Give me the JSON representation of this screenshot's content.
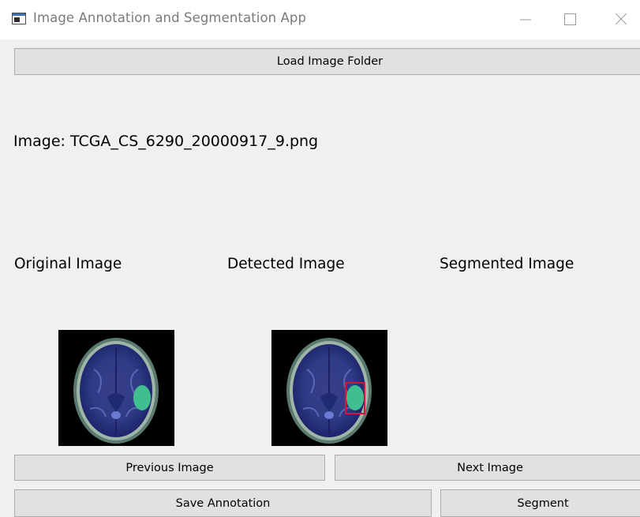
{
  "window": {
    "title": "Image Annotation and Segmentation App",
    "app_icon": "window-app-icon",
    "controls": [
      "minimize-icon",
      "maximize-icon",
      "close-icon"
    ]
  },
  "toolbar": {
    "load_label": "Load Image Folder"
  },
  "current_image": {
    "label": "Image: TCGA_CS_6290_20000917_9.png"
  },
  "panels": {
    "original": "Original Image",
    "detected": "Detected Image",
    "segmented": "Segmented Image"
  },
  "navigation": {
    "previous_label": "Previous Image",
    "next_label": "Next Image"
  },
  "actions": {
    "save_label": "Save Annotation",
    "segment_label": "Segment"
  },
  "colors": {
    "window_bg": "#f0f0f0",
    "button_bg": "#e1e1e1",
    "button_border": "#adadad",
    "detection_box": "#d4143c",
    "tumor_region": "#3fbf8f"
  }
}
